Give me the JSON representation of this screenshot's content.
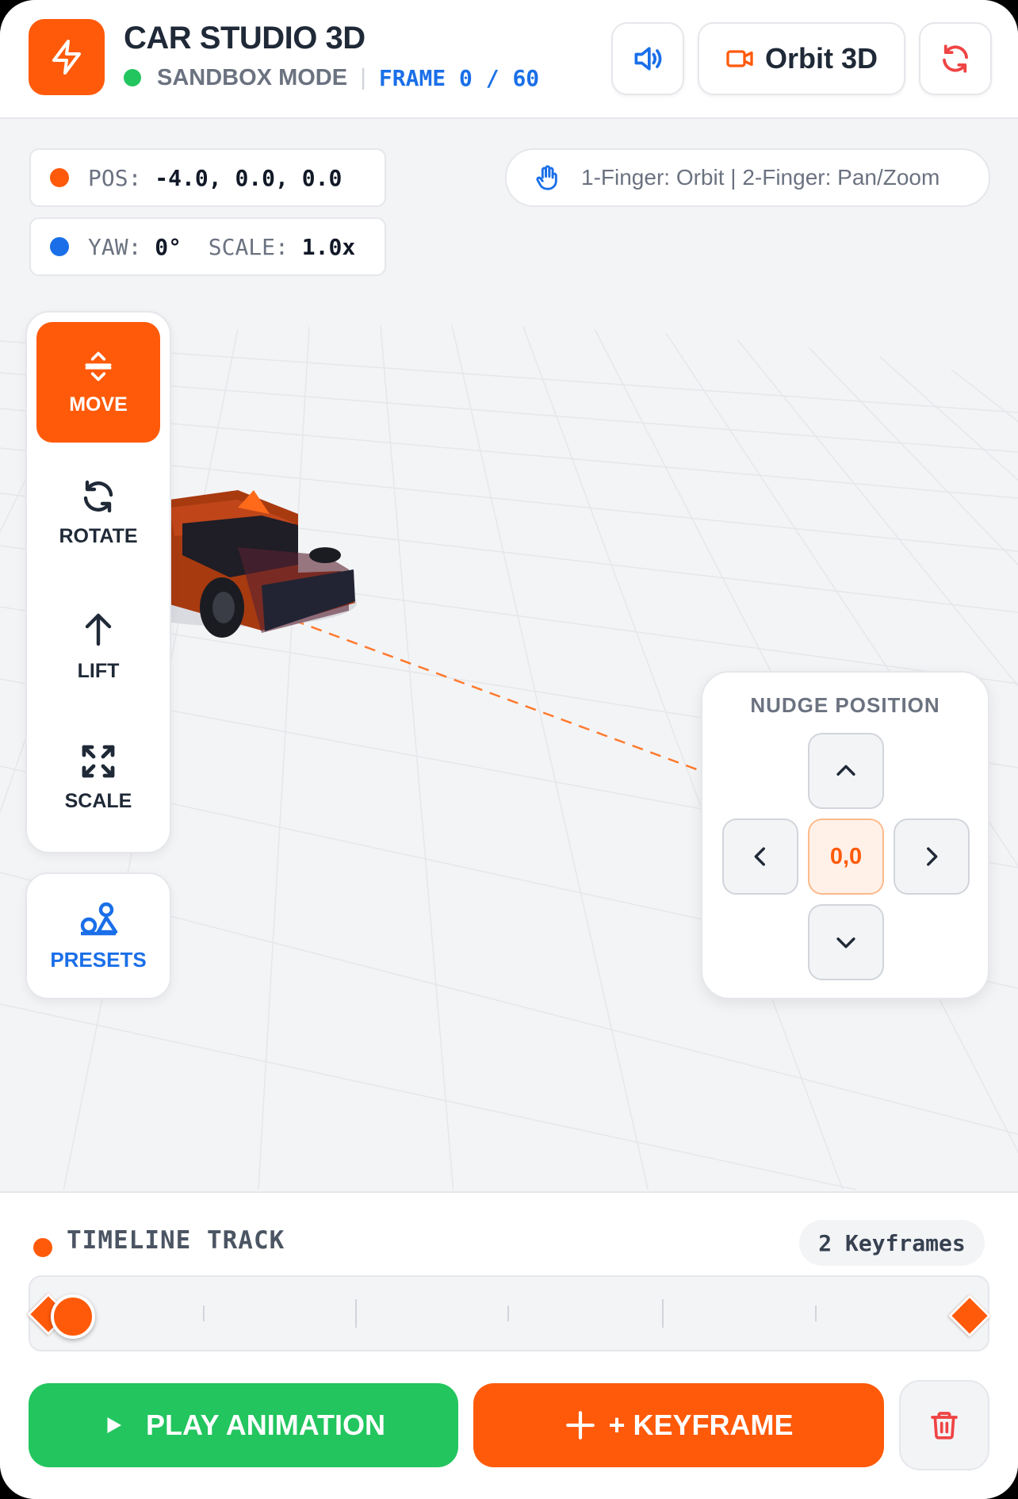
{
  "header": {
    "title": "CAR STUDIO 3D",
    "mode": "SANDBOX MODE",
    "separator": "|",
    "frame_label": "FRAME 0 / 60",
    "camera_button": "Orbit 3D",
    "icons": [
      "bolt-icon",
      "speaker-icon",
      "video-camera-icon",
      "refresh-icon"
    ]
  },
  "readouts": {
    "pos_label": "POS:",
    "pos_value": "-4.0, 0.0, 0.0",
    "yaw_label": "YAW:",
    "yaw_value": "0°",
    "scale_label": "SCALE:",
    "scale_value": "1.0x"
  },
  "hint": {
    "text": "1-Finger: Orbit | 2-Finger: Pan/Zoom",
    "icon": "hand-icon"
  },
  "toolbar": {
    "tools": [
      {
        "label": "MOVE",
        "icon": "move-vertical-icon",
        "active": true
      },
      {
        "label": "ROTATE",
        "icon": "rotate-icon",
        "active": false
      },
      {
        "label": "LIFT",
        "icon": "arrow-up-icon",
        "active": false
      },
      {
        "label": "SCALE",
        "icon": "expand-icon",
        "active": false
      }
    ],
    "presets_label": "PRESETS"
  },
  "nudge": {
    "title": "NUDGE POSITION",
    "center_value": "0,0"
  },
  "timeline": {
    "title": "TIMELINE TRACK",
    "keyframes_badge": "2 Keyframes",
    "current_frame": 0,
    "total_frames": 60,
    "keyframe_frames": [
      0,
      60
    ]
  },
  "actions": {
    "play_label": "PLAY ANIMATION",
    "keyframe_label": "+ KEYFRAME"
  },
  "colors": {
    "accent": "#ff5a0a",
    "blue": "#1a6fe8",
    "green": "#22c55e",
    "danger": "#ef4444"
  }
}
